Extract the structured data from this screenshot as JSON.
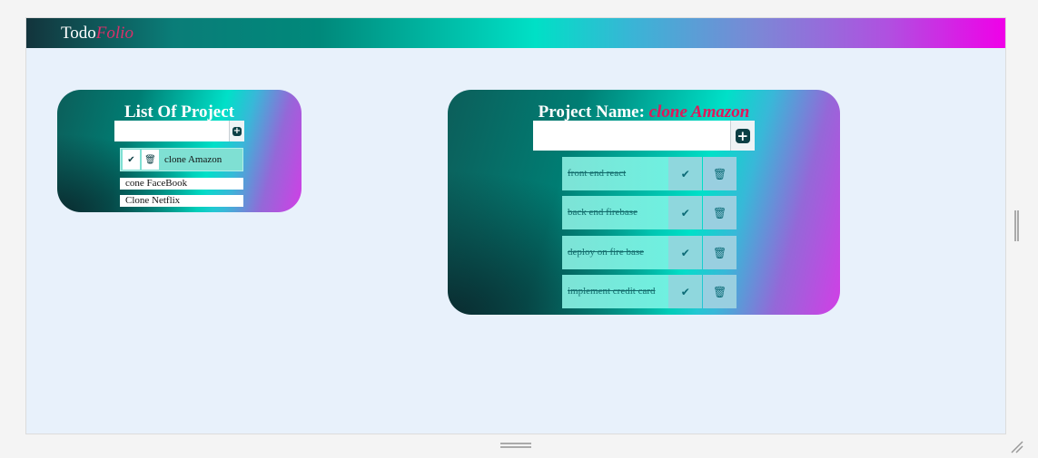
{
  "brand": {
    "part1": "Todo",
    "part2": "Folio"
  },
  "projects_panel": {
    "title": "List Of Project",
    "input_value": "",
    "active_project": "clone Amazon",
    "done_icon": "check-icon",
    "delete_icon": "trash-icon",
    "items": [
      "cone FaceBook",
      "Clone Netflix"
    ]
  },
  "tasks_panel": {
    "title_prefix": "Project Name:",
    "project_name": "clone Amazon",
    "input_value": "",
    "tasks": [
      {
        "label": "front end react",
        "completed": true
      },
      {
        "label": "back end firebase",
        "completed": true
      },
      {
        "label": "deploy on fire base",
        "completed": true
      },
      {
        "label": "implement credit card",
        "completed": true
      }
    ]
  },
  "colors": {
    "brand_accent": "#d9306a",
    "project_name_accent": "#e0185a",
    "icon_dark": "#0b3f45"
  }
}
